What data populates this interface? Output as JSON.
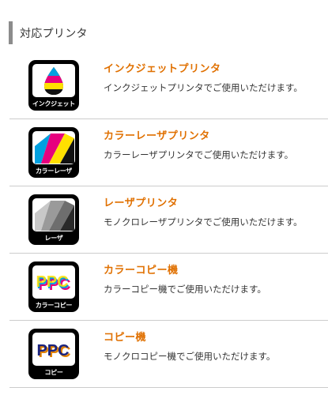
{
  "section": {
    "title": "対応プリンタ"
  },
  "colors": {
    "accent": "#e07000",
    "divider": "#cccccc",
    "header_bar": "#8c8c8c"
  },
  "printers": [
    {
      "icon": "inkjet-icon",
      "caption": "インクジェット",
      "name": "インクジェットプリンタ",
      "desc": "インクジェットプリンタでご使用いただけます。"
    },
    {
      "icon": "color-laser-icon",
      "caption": "カラーレーザ",
      "name": "カラーレーザプリンタ",
      "desc": "カラーレーザプリンタでご使用いただけます。"
    },
    {
      "icon": "laser-icon",
      "caption": "レーザ",
      "name": "レーザプリンタ",
      "desc": "モノクロレーザプリンタでご使用いただけます。"
    },
    {
      "icon": "color-copier-icon",
      "caption": "カラーコピー",
      "label": "PPC",
      "name": "カラーコピー機",
      "desc": "カラーコピー機でご使用いただけます。"
    },
    {
      "icon": "copier-icon",
      "caption": "コピー",
      "label": "PPC",
      "name": "コピー機",
      "desc": "モノクロコピー機でご使用いただけます。"
    }
  ]
}
